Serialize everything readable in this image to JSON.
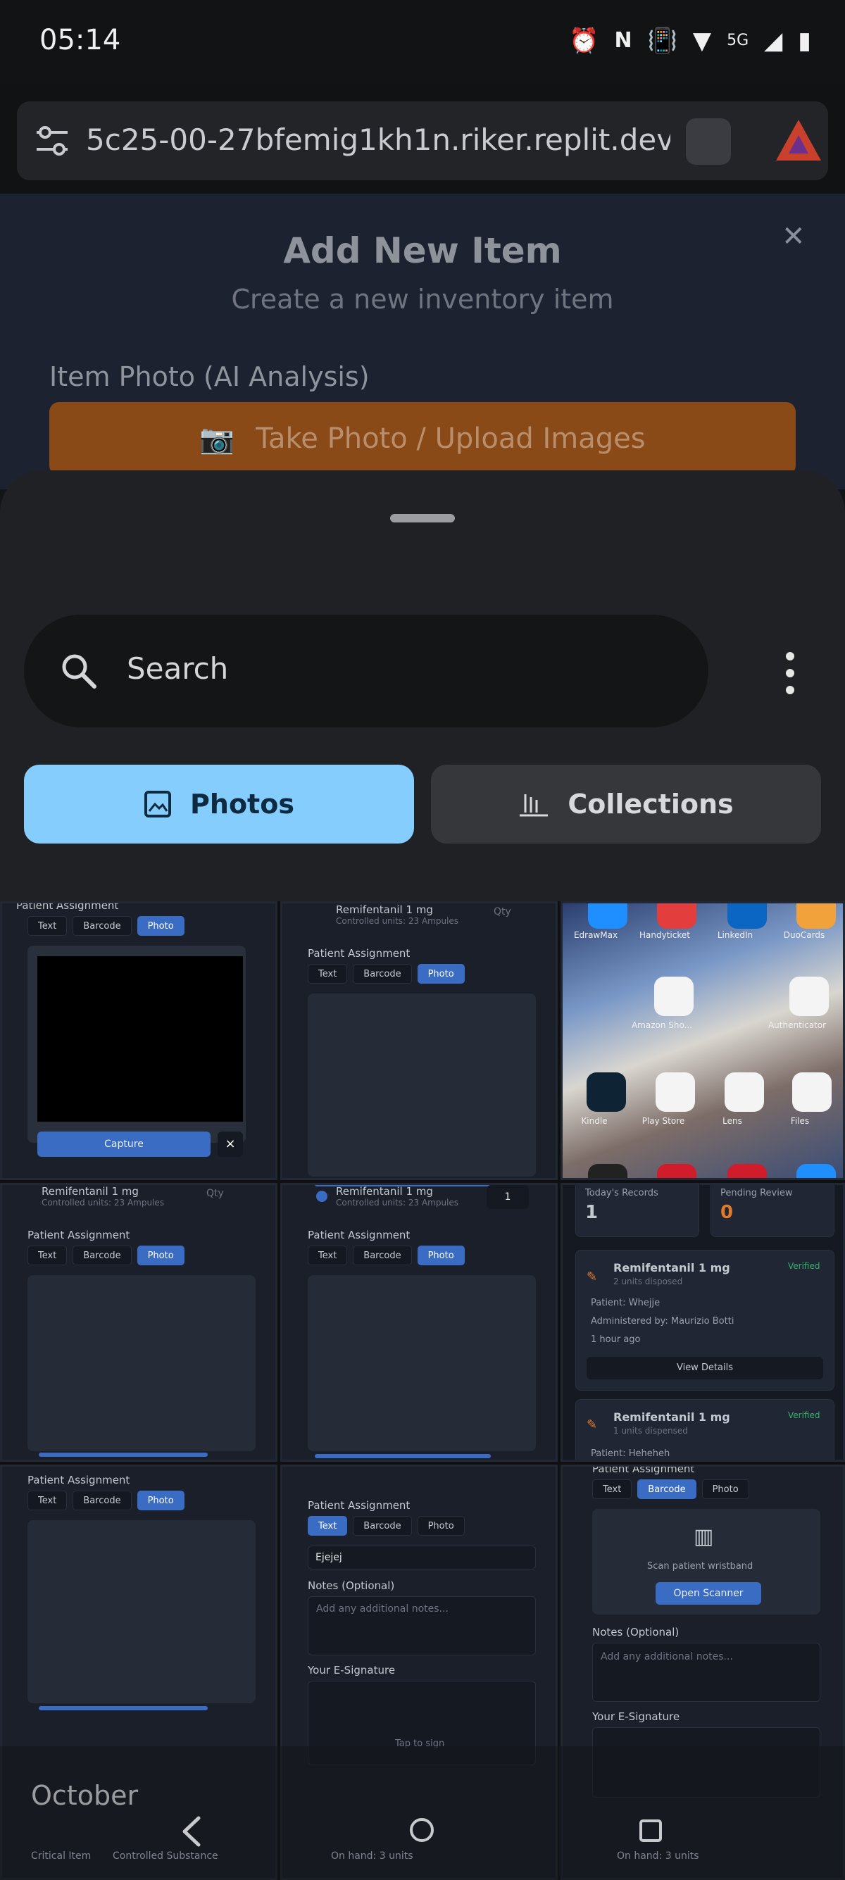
{
  "status_bar": {
    "time": "05:14",
    "network_label": "5G"
  },
  "browser": {
    "url": "5c25-00-27bfemig1kh1n.riker.replit.dev"
  },
  "background_page": {
    "title": "Add New Item",
    "subtitle": "Create a new inventory item",
    "photo_label": "Item Photo (AI Analysis)",
    "upload_button": "Take Photo / Upload Images"
  },
  "picker": {
    "search_placeholder": "Search",
    "tabs": [
      {
        "label": "Photos",
        "selected": true
      },
      {
        "label": "Collections",
        "selected": false
      }
    ],
    "month_header": "October"
  },
  "thumbs": {
    "common": {
      "patient_assignment": "Patient Assignment",
      "seg_text": "Text",
      "seg_barcode": "Barcode",
      "seg_photo": "Photo",
      "drug": "Remifentanil 1 mg",
      "controlled_units": "Controlled units: 23 Ampules",
      "qty_placeholder": "Qty",
      "qty_one": "1",
      "notes_label": "Notes (Optional)",
      "notes_placeholder": "Add any additional notes...",
      "esign_label": "Your E-Signature",
      "tap_to_sign": "Tap to sign",
      "capture": "Capture",
      "close_x": "×"
    },
    "text_input_value": "Ejejej",
    "dashboard": {
      "todays_records_label": "Today's Records",
      "todays_records_value": "1",
      "pending_review_label": "Pending Review",
      "pending_review_value": "0",
      "record1_title": "Remifentanil 1 mg",
      "record1_units": "2 units disposed",
      "record1_status": "Verified",
      "record1_patient": "Patient: Whejje",
      "record1_admin": "Administered by: Maurizio Botti",
      "record1_time": "1 hour ago",
      "view_details": "View Details",
      "record2_title": "Remifentanil 1 mg",
      "record2_units": "1 units dispensed",
      "record2_status": "Verified",
      "record2_patient": "Patient: Heheheh"
    },
    "barcode_panel": {
      "scan_text": "Scan patient wristband",
      "open_scanner": "Open Scanner"
    },
    "home_apps": [
      "EdrawMax",
      "Handyticket",
      "LinkedIn",
      "DuoCards",
      "Amazon Sho...",
      "Authenticator",
      "Kindle",
      "Play Store",
      "Lens",
      "Files"
    ],
    "bottom_chips": {
      "critical": "Critical Item",
      "controlled": "Controlled Substance",
      "on_hand": "On hand: 3 units"
    }
  },
  "colors": {
    "accent_blue": "#3b6cc4",
    "tab_selected": "#85cdfc",
    "verified_green": "#35b36b",
    "pending_orange": "#e07b2a"
  }
}
